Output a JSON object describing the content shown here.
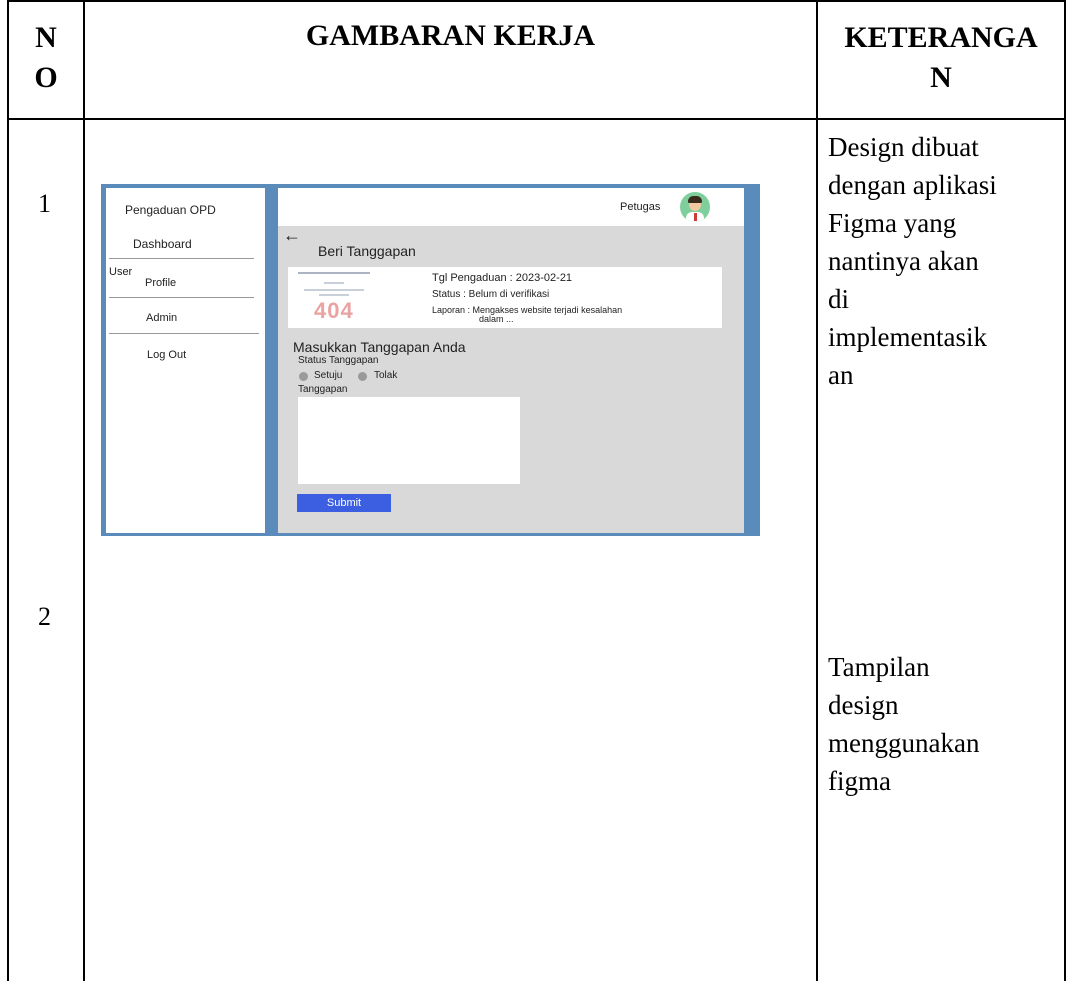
{
  "table": {
    "headers": {
      "no_line1": "N",
      "no_line2": "O",
      "gambaran": "GAMBARAN KERJA",
      "keterangan_line1": "KETERANGA",
      "keterangan_line2": "N"
    },
    "rows": [
      {
        "no": "1",
        "keterangan_lines": [
          "Design dibuat",
          "dengan aplikasi",
          "Figma yang",
          "nantinya akan",
          "di",
          "implementasik",
          "an"
        ]
      },
      {
        "no": "2",
        "keterangan_lines": [
          "Tampilan",
          "design",
          "menggunakan",
          "figma"
        ]
      }
    ]
  },
  "mockup": {
    "sidebar": {
      "title": "Pengaduan OPD",
      "items": [
        "Dashboard",
        "User",
        "Profile",
        "Admin",
        "Log Out"
      ]
    },
    "topbar": {
      "user_label": "Petugas",
      "avatar_icon": "user-avatar-icon"
    },
    "main": {
      "back_icon": "←",
      "page_title": "Beri Tanggapan",
      "complaint": {
        "thumbnail_text": "404",
        "date": "Tgl Pengaduan : 2023-02-21",
        "status": "Status : Belum di verifikasi",
        "report_line1": "Laporan : Mengakses website terjadi kesalahan",
        "report_line2": "dalam ..."
      },
      "form": {
        "section_title": "Masukkan Tanggapan Anda",
        "status_label": "Status Tanggapan",
        "options": [
          "Setuju",
          "Tolak"
        ],
        "response_label": "Tanggapan",
        "submit_label": "Submit"
      }
    },
    "colors": {
      "frame": "#5b8bbb",
      "content_bg": "#d9d9d9",
      "submit_bg": "#3b5fe0",
      "avatar_bg": "#7fcf9c"
    }
  }
}
